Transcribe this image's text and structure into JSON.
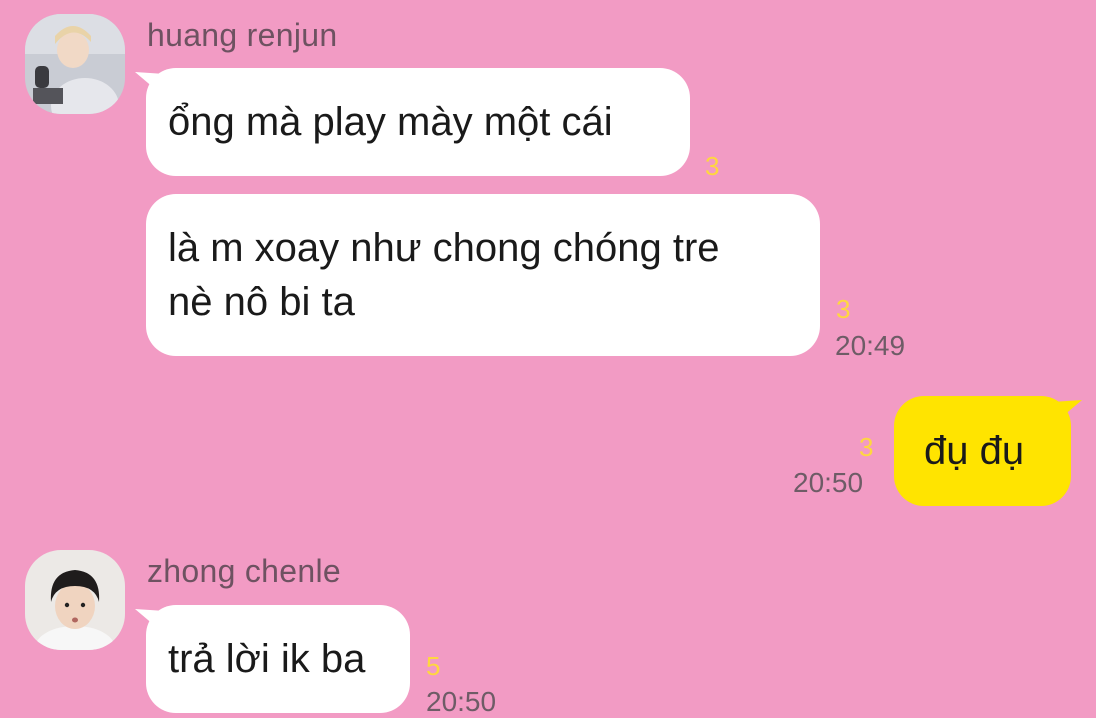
{
  "conversation": {
    "colors": {
      "background": "#f29bc4",
      "bubble_incoming": "#ffffff",
      "bubble_outgoing": "#ffe400",
      "unread": "#ffd73f"
    },
    "group1": {
      "sender": "huang renjun",
      "avatar_icon": "profile-photo-icon",
      "msg1": {
        "text": "ổng mà play mày một cái",
        "unread": "3"
      },
      "msg2": {
        "line1": "là m xoay như chong chóng tre",
        "line2": "nè nô bi ta",
        "unread": "3",
        "time": "20:49"
      }
    },
    "outgoing": {
      "text": "đụ đụ",
      "unread": "3",
      "time": "20:50"
    },
    "group2": {
      "sender": "zhong chenle",
      "avatar_icon": "profile-photo-icon",
      "msg1": {
        "text": "trả lời ik ba",
        "unread": "5",
        "time": "20:50"
      }
    }
  }
}
